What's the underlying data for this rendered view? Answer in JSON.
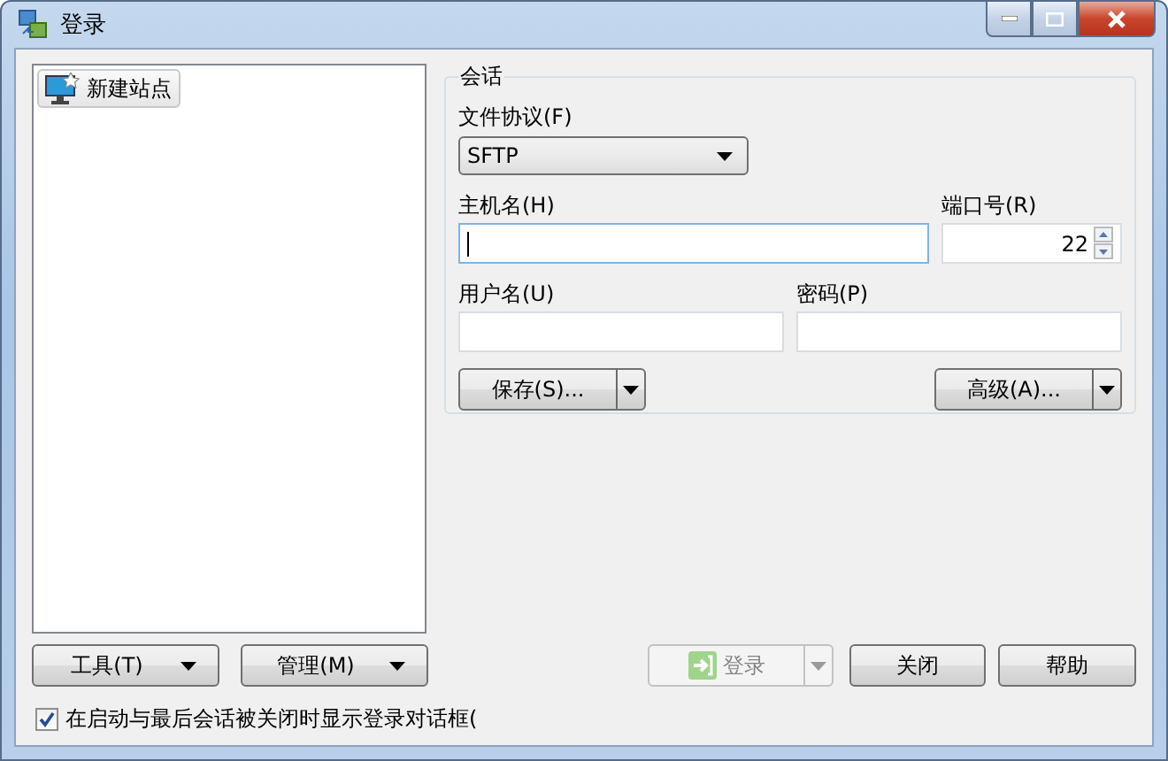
{
  "window": {
    "title": "登录"
  },
  "site_tree": {
    "items": [
      {
        "label": "新建站点",
        "selected": true
      }
    ]
  },
  "session": {
    "title": "会话",
    "protocol": {
      "label": "文件协议(F)",
      "value": "SFTP"
    },
    "host": {
      "label": "主机名(H)",
      "focused": true
    },
    "port": {
      "label": "端口号(R)",
      "value": "22"
    },
    "username": {
      "label": "用户名(U)"
    },
    "password": {
      "label": "密码(P)"
    },
    "save_button": {
      "label": "保存(S)..."
    },
    "advanced_button": {
      "label": "高级(A)..."
    }
  },
  "left_buttons": [
    {
      "label": "工具(T)"
    },
    {
      "label": "管理(M)"
    }
  ],
  "login_button": {
    "label": "登录",
    "disabled": true
  },
  "buttons": [
    {
      "label": "关闭"
    },
    {
      "label": "帮助"
    }
  ],
  "show_on_startup": {
    "label": "在启动与最后会话被关闭时显示登录对话框(",
    "checked": true
  }
}
